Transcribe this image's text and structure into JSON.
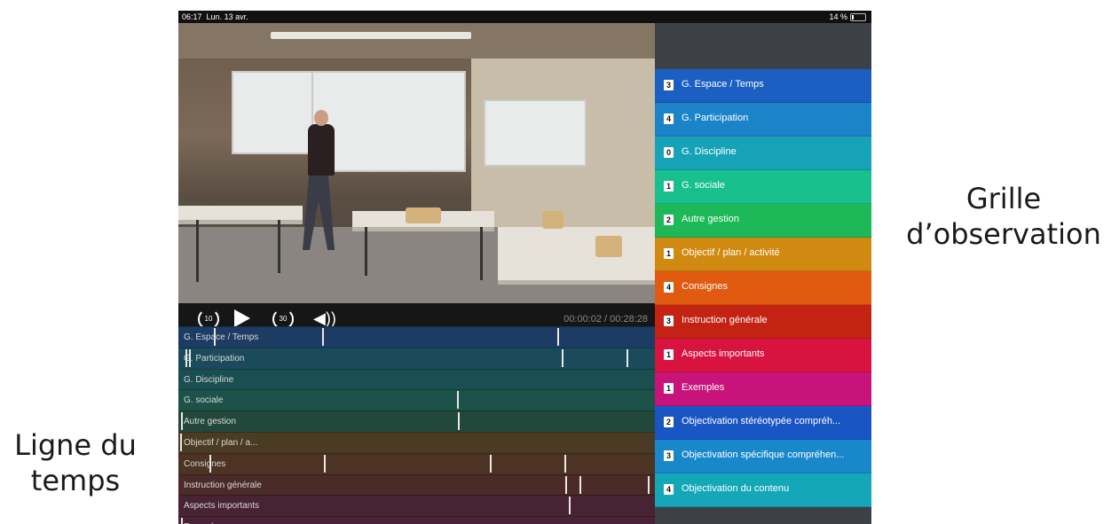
{
  "status": {
    "time": "06:17",
    "date": "Lun. 13 avr.",
    "battery": "14 %"
  },
  "player": {
    "current": "00:00:02",
    "duration": "00:28:28",
    "skip_back": "10",
    "skip_fwd": "30"
  },
  "timeline": [
    {
      "label": "G. Espace / Temps",
      "color": "#1d3c63",
      "ticks": [
        0.074,
        0.301,
        0.795
      ]
    },
    {
      "label": "G. Participation",
      "color": "#1b4a5a",
      "ticks": [
        0.015,
        0.023,
        0.805,
        0.94
      ]
    },
    {
      "label": "G. Discipline",
      "color": "#1b4e50",
      "ticks": []
    },
    {
      "label": "G. sociale",
      "color": "#1c5248",
      "ticks": [
        0.584
      ]
    },
    {
      "label": "Autre gestion",
      "color": "#22483c",
      "ticks": [
        0.005,
        0.587
      ]
    },
    {
      "label": "Objectif / plan / a...",
      "color": "#4a3b24",
      "ticks": [
        0.004
      ]
    },
    {
      "label": "Consignes",
      "color": "#4c3323",
      "ticks": [
        0.065,
        0.306,
        0.654,
        0.81
      ]
    },
    {
      "label": "Instruction générale",
      "color": "#4a2b28",
      "ticks": [
        0.811,
        0.842,
        0.985
      ]
    },
    {
      "label": "Aspects importants",
      "color": "#462432",
      "ticks": [
        0.82
      ]
    },
    {
      "label": "Exemples",
      "color": "#4a2238",
      "ticks": [
        0.005
      ]
    }
  ],
  "grid": [
    {
      "count": "3",
      "label": "G. Espace / Temps",
      "color": "#1b5fc2"
    },
    {
      "count": "4",
      "label": "G. Participation",
      "color": "#1b84c9"
    },
    {
      "count": "0",
      "label": "G. Discipline",
      "color": "#16a3b8"
    },
    {
      "count": "1",
      "label": "G. sociale",
      "color": "#17c08e"
    },
    {
      "count": "2",
      "label": "Autre gestion",
      "color": "#1db857"
    },
    {
      "count": "1",
      "label": "Objectif / plan / activité",
      "color": "#d18a11"
    },
    {
      "count": "4",
      "label": "Consignes",
      "color": "#e05a0f"
    },
    {
      "count": "3",
      "label": "Instruction générale",
      "color": "#c42213"
    },
    {
      "count": "1",
      "label": "Aspects importants",
      "color": "#d8133f"
    },
    {
      "count": "1",
      "label": "Exemples",
      "color": "#c8137b"
    },
    {
      "count": "2",
      "label": "Objectivation stéréotypée compréh...",
      "color": "#1a55c4"
    },
    {
      "count": "3",
      "label": "Objectivation spécifique compréhen...",
      "color": "#1888cb"
    },
    {
      "count": "4",
      "label": "Objectivation du contenu",
      "color": "#14a7b8"
    }
  ],
  "annotations": {
    "grille": "Grille d’observation",
    "ligne": "Ligne du temps"
  }
}
